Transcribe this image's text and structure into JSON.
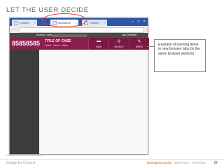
{
  "slide": {
    "title": "LET THE USER DECIDE",
    "screenshot_ref": "CELNICKEMU DATA SERVANT"
  },
  "browser": {
    "tabs": [
      {
        "label": "Untitled",
        "active": false
      },
      {
        "label": "85858585",
        "active": true
      },
      {
        "label": "Untitled",
        "active": false
      }
    ],
    "window_controls": [
      "–",
      "□",
      "×"
    ],
    "nav_back": "‹",
    "nav_forward": "›"
  },
  "app": {
    "search_label": "Search Cases",
    "user_label": "Jan Whieber",
    "case": {
      "number": "85858585",
      "title": "TITLE OF CASE",
      "subtabs": [
        "Notes",
        "Views",
        "Video"
      ]
    },
    "actions": [
      {
        "label": "VIEW",
        "icon": "view-icon",
        "glyph": "▬"
      },
      {
        "label": "SEARCH",
        "icon": "search-icon",
        "glyph": "⚲"
      },
      {
        "label": "WRITE",
        "icon": "pencil-icon",
        "glyph": "✎"
      }
    ]
  },
  "callout": {
    "text": "Example of opening items in new browser tabs (in the same browser window)"
  },
  "footer": {
    "left": "Design for Context",
    "right_prefix": "@designforcontext",
    "right_suffix": "· Seth Force · IAPA 2017",
    "page": "27"
  },
  "colors": {
    "accent": "#8a1e4d",
    "tabstrip": "#2d57a8",
    "highlight": "#e8372c",
    "footer_accent": "#c55a11"
  }
}
